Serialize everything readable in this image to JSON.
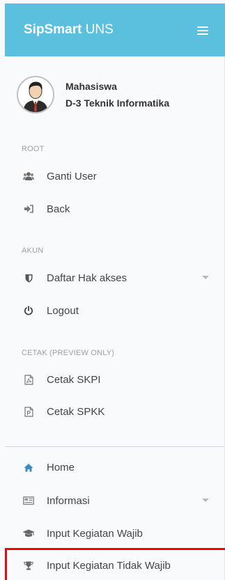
{
  "header": {
    "brand_bold": "SipSmart",
    "brand_rest": " UNS",
    "menu_icon": "hamburger-icon"
  },
  "user": {
    "name": "Mahasiswa",
    "program": "D-3 Teknik Informatika",
    "avatar_icon": "user-avatar"
  },
  "sections": {
    "root": "ROOT",
    "akun": "AKUN",
    "cetak": "CETAK (PREVIEW ONLY)"
  },
  "menu": {
    "ganti_user": {
      "label": "Ganti User",
      "icon": "users-icon"
    },
    "back": {
      "label": "Back",
      "icon": "sign-in-icon"
    },
    "daftar_hak_akses": {
      "label": "Daftar Hak akses",
      "icon": "shield-icon"
    },
    "logout": {
      "label": "Logout",
      "icon": "power-icon"
    },
    "cetak_skpi": {
      "label": "Cetak SKPI",
      "icon": "pdf-icon"
    },
    "cetak_spkk": {
      "label": "Cetak SPKK",
      "icon": "document-icon"
    },
    "home": {
      "label": "Home",
      "icon": "home-icon"
    },
    "informasi": {
      "label": "Informasi",
      "icon": "newspaper-icon"
    },
    "input_wajib": {
      "label": "Input Kegiatan Wajib",
      "icon": "graduation-cap-icon"
    },
    "input_tidak_wajib": {
      "label": "Input Kegiatan Tidak Wajib",
      "icon": "trophy-icon"
    }
  },
  "colors": {
    "header": "#5bc0de",
    "highlight": "#ff0000",
    "home_icon": "#3c8dbc"
  }
}
